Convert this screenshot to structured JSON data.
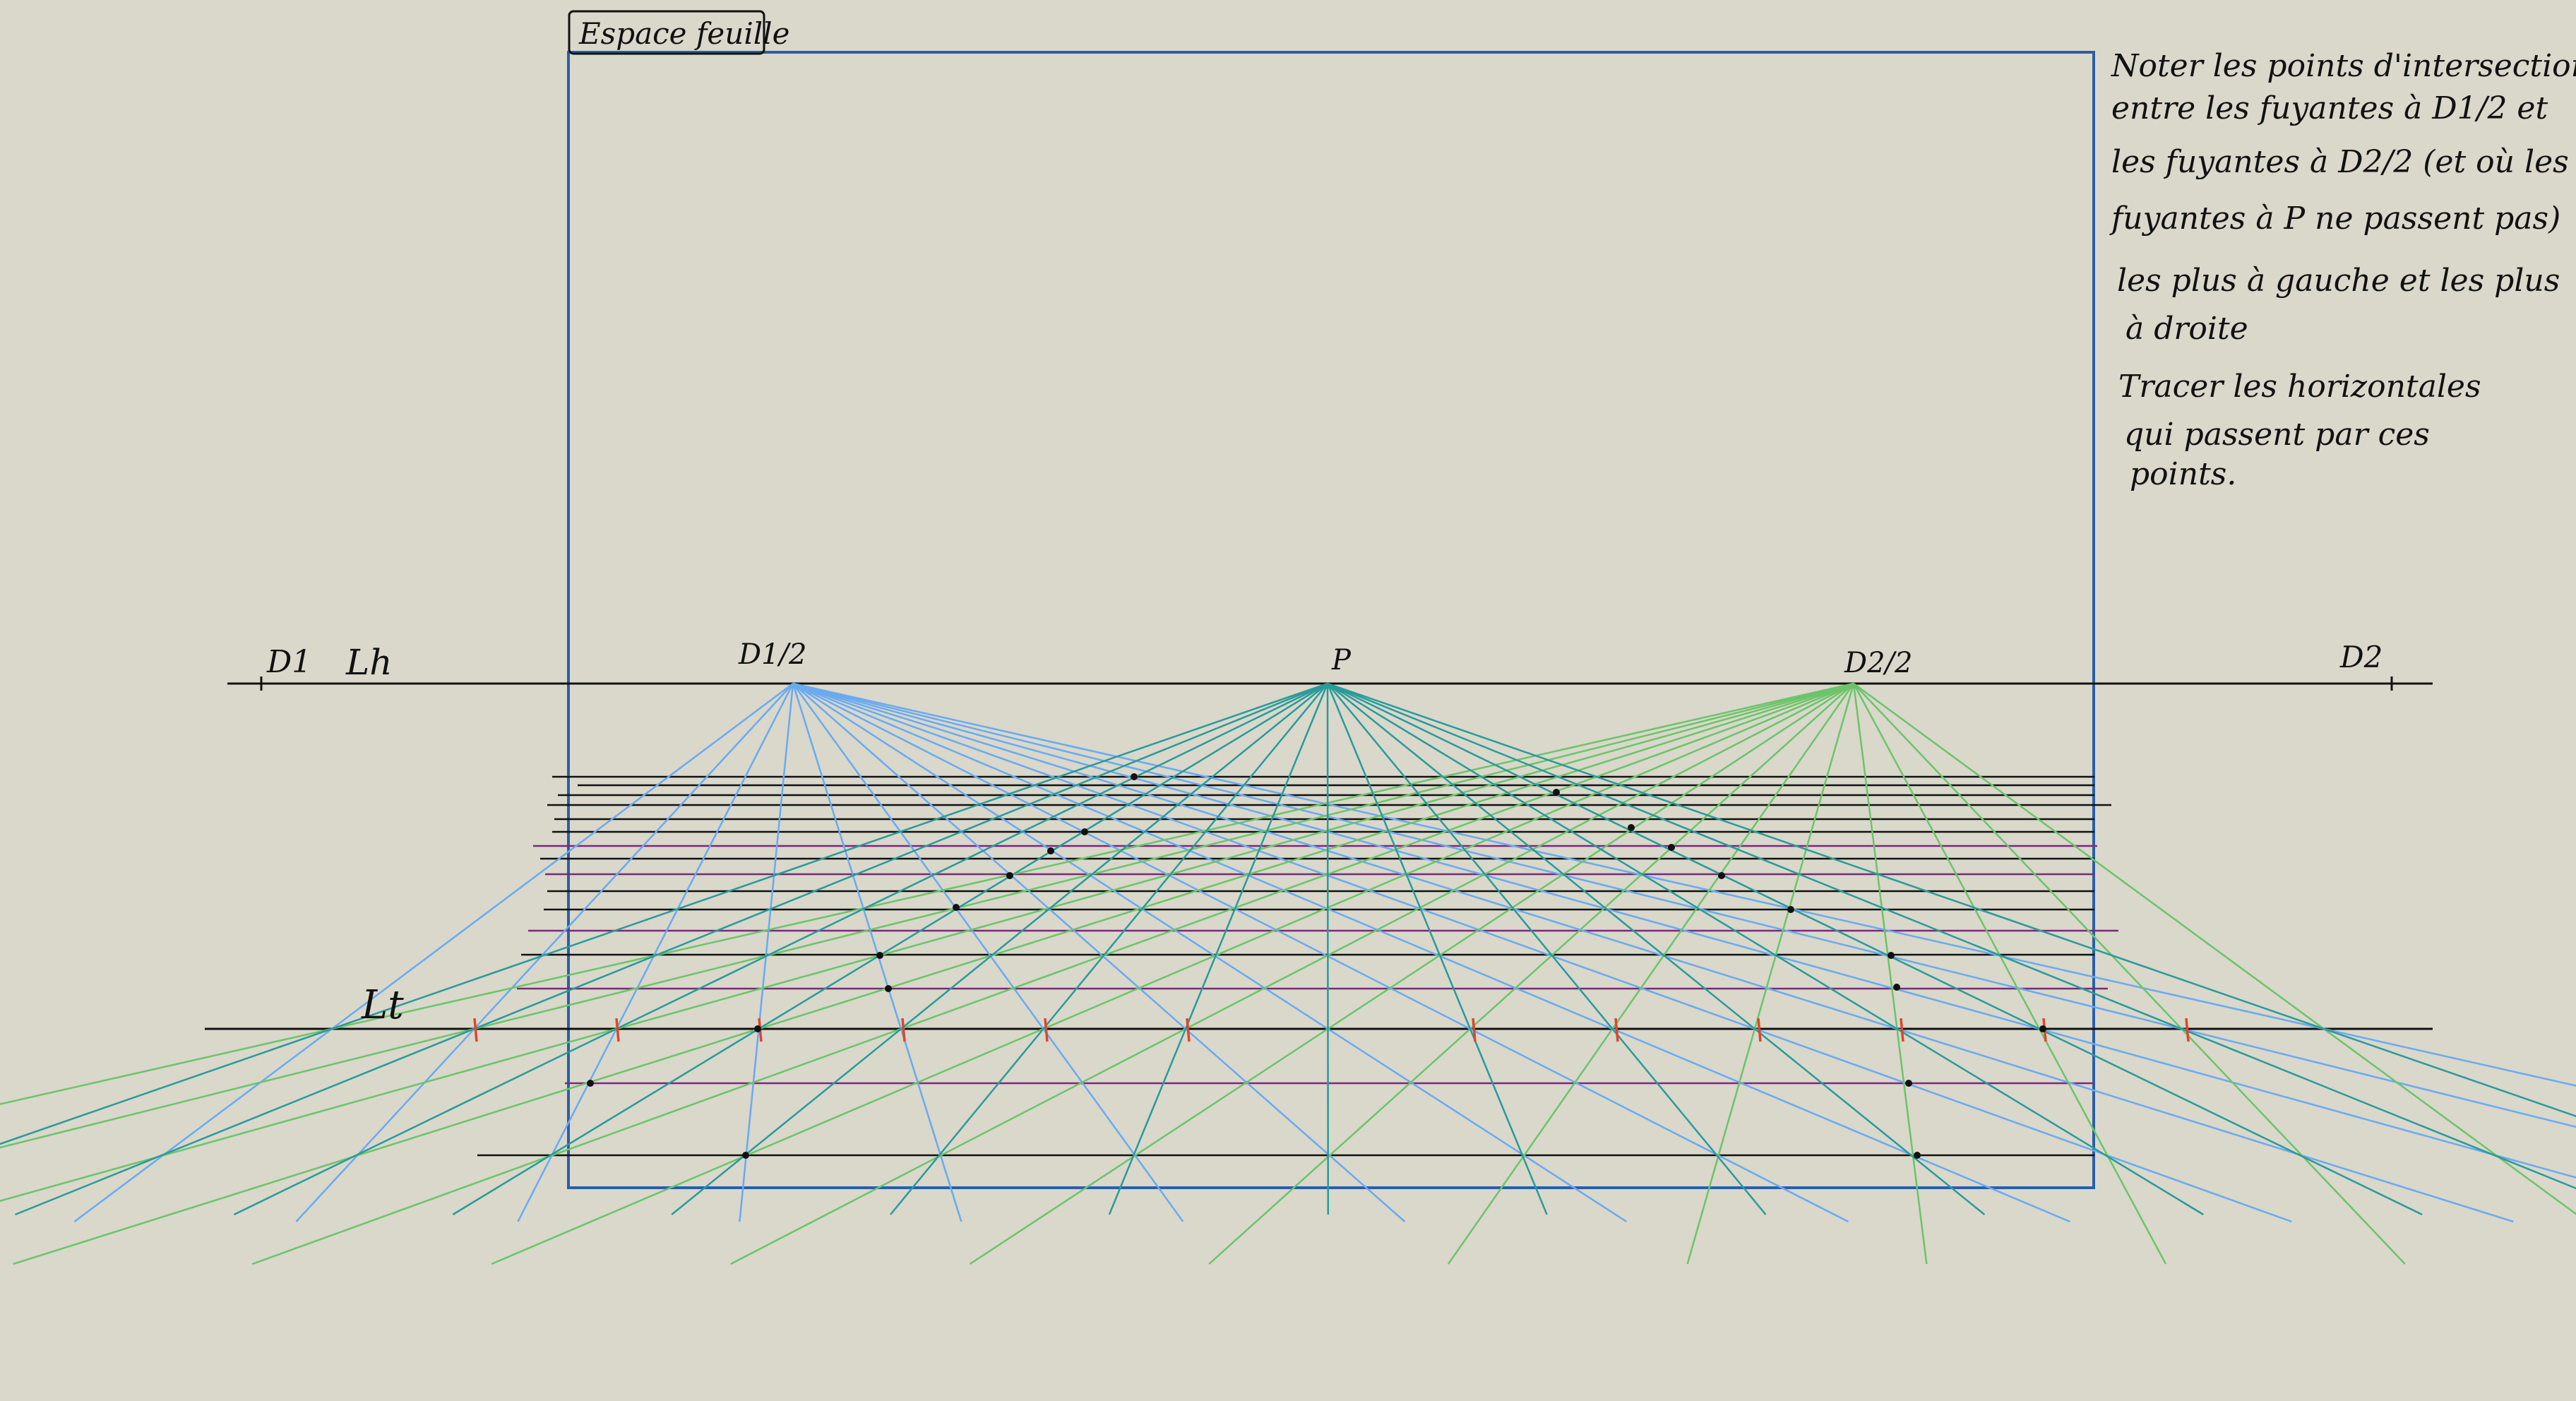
{
  "title_box": "Espace feuille",
  "labels": {
    "d1": "D1",
    "lh": "Lh",
    "d1_half": "D1/2",
    "p": "P",
    "d2_half": "D2/2",
    "d2": "D2",
    "lt": "Lt"
  },
  "notes": [
    "Noter les points d'intersection",
    "entre les fuyantes à D1/2 et",
    "les fuyantes à D2/2 (et où les",
    "fuyantes à P ne passent pas)",
    "les plus à gauche et les plus",
    "à droite",
    "Tracer les horizontales",
    "qui passent par ces",
    "points."
  ],
  "colors": {
    "background": "#d9d8cb",
    "sheet_frame": "#2a5fa8",
    "fuyante_d1_half": "#6aaaf0",
    "fuyante_p": "#2a9a9a",
    "fuyante_d2_half": "#6cc46a",
    "horizontal_black": "#111111",
    "horizontal_purple": "#7a2a7a",
    "tick_red": "#e0442a"
  }
}
